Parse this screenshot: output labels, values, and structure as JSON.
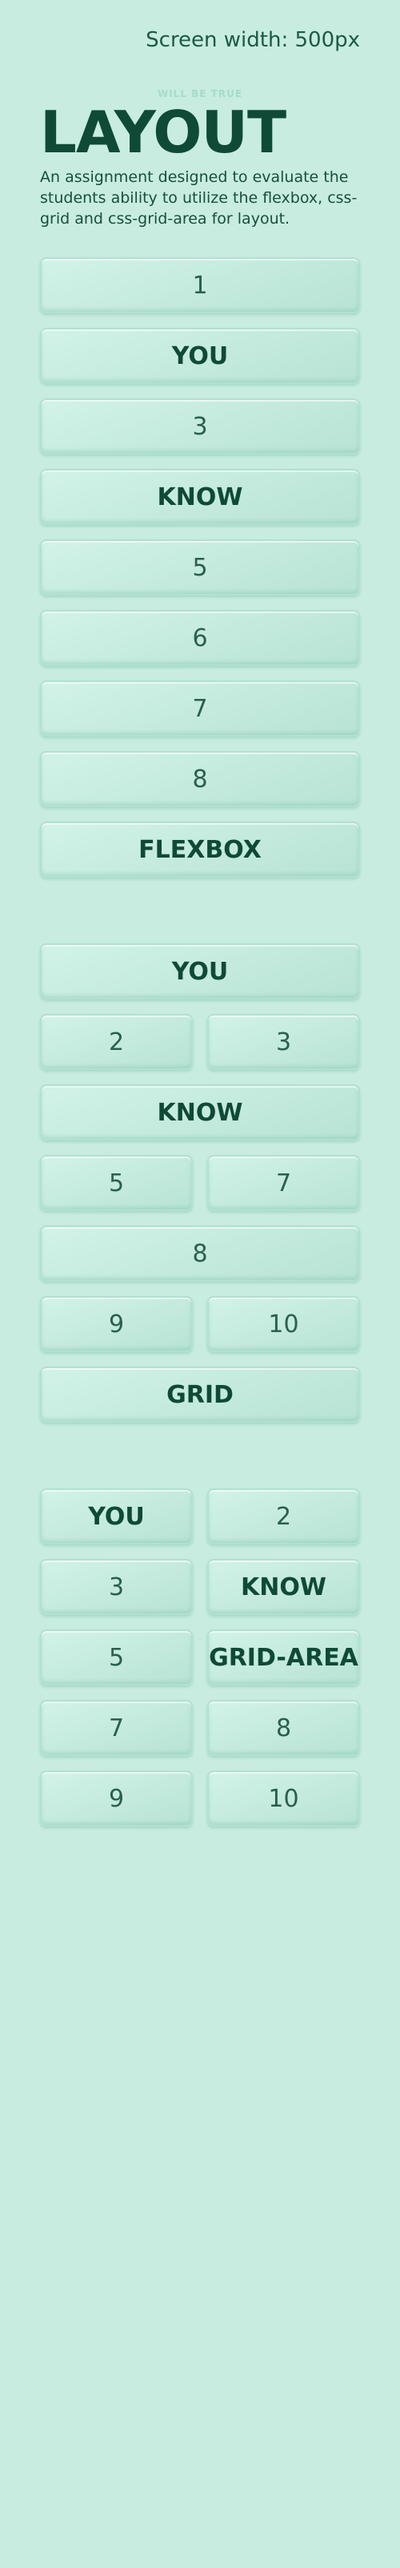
{
  "header": {
    "screen_width_label": "Screen width: 500px",
    "eyebrow": "WILL BE TRUE",
    "title": "LAYOUT",
    "description": "An assignment designed to evaluate the students ability to utilize the flexbox, css-grid and css-grid-area for layout."
  },
  "flexbox_section": {
    "items": [
      "1",
      "YOU",
      "3",
      "KNOW",
      "5",
      "6",
      "7",
      "8",
      "FLEXBOX"
    ]
  },
  "grid_section": {
    "items": [
      "YOU",
      "2",
      "3",
      "KNOW",
      "5",
      "7",
      "8",
      "9",
      "10",
      "GRID"
    ]
  },
  "grid_area_section": {
    "items": [
      "YOU",
      "2",
      "3",
      "KNOW",
      "5",
      "GRID-AREA",
      "7",
      "8",
      "9",
      "10"
    ]
  },
  "colors": {
    "background": "#c8ece0",
    "text_dark": "#0f4a37",
    "box_border": "#b2e1d0"
  }
}
